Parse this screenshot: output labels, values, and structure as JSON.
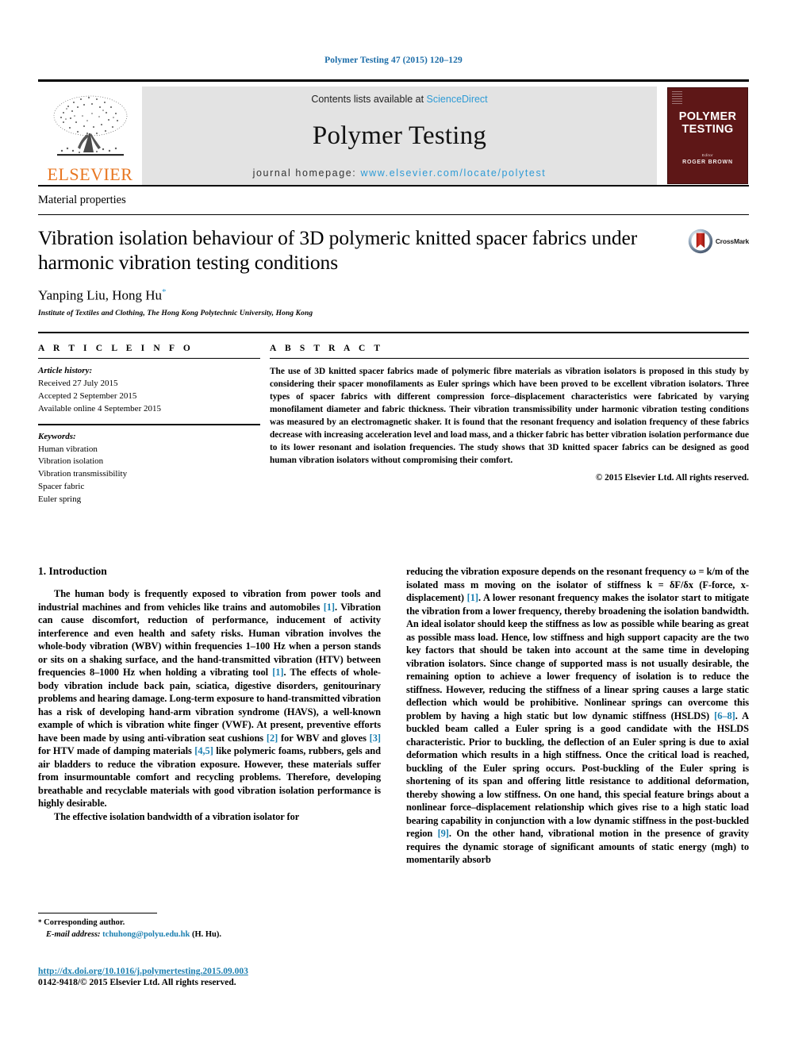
{
  "running_head": "Polymer Testing 47 (2015) 120–129",
  "masthead": {
    "publisher_name": "ELSEVIER",
    "contents_prefix": "Contents lists available at ",
    "contents_link": "ScienceDirect",
    "journal_title": "Polymer Testing",
    "homepage_prefix": "journal homepage: ",
    "homepage_url": "www.elsevier.com/locate/polytest",
    "cover": {
      "title_line1": "POLYMER",
      "title_line2": "TESTING",
      "sub": "Editor",
      "editor": "ROGER BROWN"
    }
  },
  "section_label": "Material properties",
  "article": {
    "title": "Vibration isolation behaviour of 3D polymeric knitted spacer fabrics under harmonic vibration testing conditions",
    "crossmark_label": "CrossMark",
    "authors": "Yanping Liu, Hong Hu",
    "corresponding_star": "*",
    "affiliation": "Institute of Textiles and Clothing, The Hong Kong Polytechnic University, Hong Kong"
  },
  "article_info": {
    "heading": "A R T I C L E  I N F O",
    "history_label": "Article history:",
    "history": [
      "Received 27 July 2015",
      "Accepted 2 September 2015",
      "Available online 4 September 2015"
    ],
    "keywords_label": "Keywords:",
    "keywords": [
      "Human vibration",
      "Vibration isolation",
      "Vibration transmissibility",
      "Spacer fabric",
      "Euler spring"
    ]
  },
  "abstract": {
    "heading": "A B S T R A C T",
    "text": "The use of 3D knitted spacer fabrics made of polymeric fibre materials as vibration isolators is proposed in this study by considering their spacer monofilaments as Euler springs which have been proved to be excellent vibration isolators. Three types of spacer fabrics with different compression force–displacement characteristics were fabricated by varying monofilament diameter and fabric thickness. Their vibration transmissibility under harmonic vibration testing conditions was measured by an electromagnetic shaker. It is found that the resonant frequency and isolation frequency of these fabrics decrease with increasing acceleration level and load mass, and a thicker fabric has better vibration isolation performance due to its lower resonant and isolation frequencies. The study shows that 3D knitted spacer fabrics can be designed as good human vibration isolators without compromising their comfort.",
    "copyright": "© 2015 Elsevier Ltd. All rights reserved."
  },
  "body": {
    "intro_heading": "1. Introduction",
    "left_paragraphs": [
      "The human body is frequently exposed to vibration from power tools and industrial machines and from vehicles like trains and automobiles [1]. Vibration can cause discomfort, reduction of performance, inducement of activity interference and even health and safety risks. Human vibration involves the whole-body vibration (WBV) within frequencies 1–100 Hz when a person stands or sits on a shaking surface, and the hand-transmitted vibration (HTV) between frequencies 8–1000 Hz when holding a vibrating tool [1]. The effects of whole-body vibration include back pain, sciatica, digestive disorders, genitourinary problems and hearing damage. Long-term exposure to hand-transmitted vibration has a risk of developing hand-arm vibration syndrome (HAVS), a well-known example of which is vibration white finger (VWF). At present, preventive efforts have been made by using anti-vibration seat cushions [2] for WBV and gloves [3] for HTV made of damping materials [4,5] like polymeric foams, rubbers, gels and air bladders to reduce the vibration exposure. However, these materials suffer from insurmountable comfort and recycling problems. Therefore, developing breathable and recyclable materials with good vibration isolation performance is highly desirable.",
      "The effective isolation bandwidth of a vibration isolator for"
    ],
    "right_paragraphs": [
      "reducing the vibration exposure depends on the resonant frequency ω = k/m of the isolated mass m moving on the isolator of stiffness k = δF/δx (F-force, x-displacement) [1]. A lower resonant frequency makes the isolator start to mitigate the vibration from a lower frequency, thereby broadening the isolation bandwidth. An ideal isolator should keep the stiffness as low as possible while bearing as great as possible mass load. Hence, low stiffness and high support capacity are the two key factors that should be taken into account at the same time in developing vibration isolators. Since change of supported mass is not usually desirable, the remaining option to achieve a lower frequency of isolation is to reduce the stiffness. However, reducing the stiffness of a linear spring causes a large static deflection which would be prohibitive. Nonlinear springs can overcome this problem by having a high static but low dynamic stiffness (HSLDS) [6–8]. A buckled beam called a Euler spring is a good candidate with the HSLDS characteristic. Prior to buckling, the deflection of an Euler spring is due to axial deformation which results in a high stiffness. Once the critical load is reached, buckling of the Euler spring occurs. Post-buckling of the Euler spring is shortening of its span and offering little resistance to additional deformation, thereby showing a low stiffness. On one hand, this special feature brings about a nonlinear force–displacement relationship which gives rise to a high static load bearing capability in conjunction with a low dynamic stiffness in the post-buckled region [9]. On the other hand, vibrational motion in the presence of gravity requires the dynamic storage of significant amounts of static energy (mgh) to momentarily absorb"
    ]
  },
  "footer": {
    "corresponding_star": "*",
    "corresponding_text": "Corresponding author.",
    "email_label": "E-mail address:",
    "email": "tchuhong@polyu.edu.hk",
    "email_suffix": "(H. Hu).",
    "doi": "http://dx.doi.org/10.1016/j.polymertesting.2015.09.003",
    "issn_line": "0142-9418/© 2015 Elsevier Ltd. All rights reserved."
  },
  "colors": {
    "link_blue": "#1b7fb0",
    "header_blue": "#1b6ca8",
    "science_direct_blue": "#2e9bd6",
    "elsevier_orange": "#E87722",
    "cover_maroon": "#5e1717"
  }
}
